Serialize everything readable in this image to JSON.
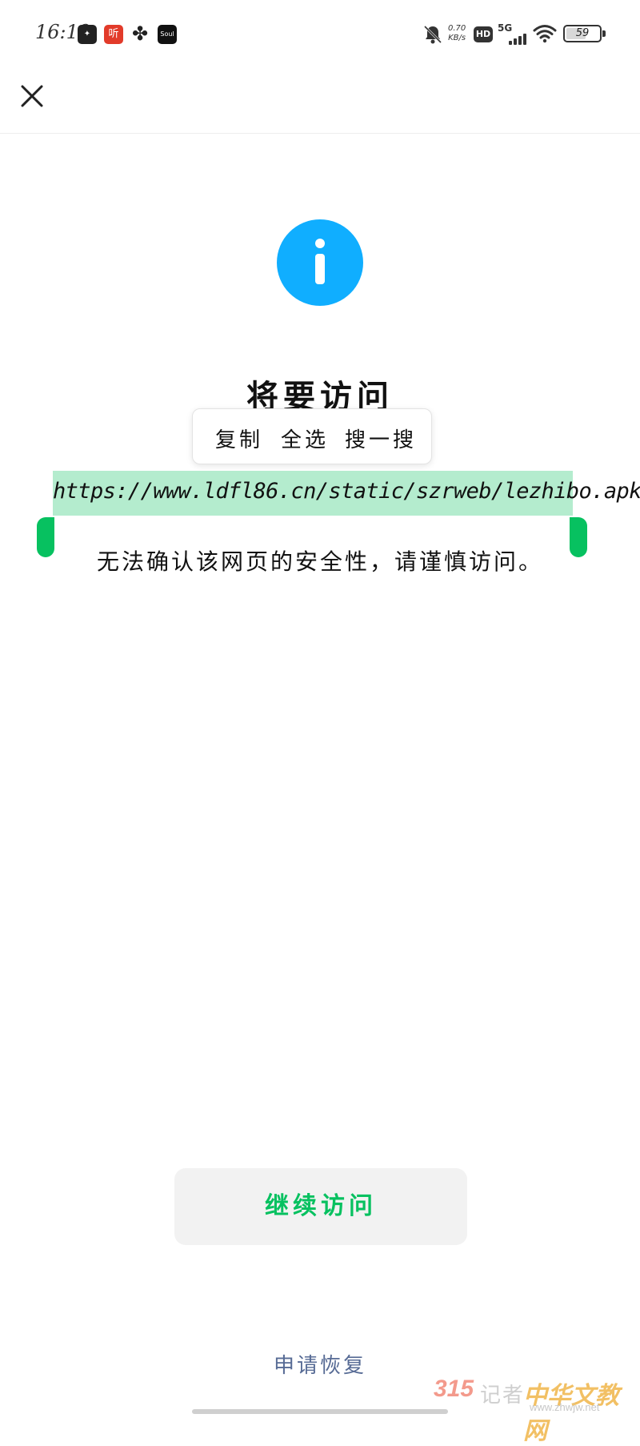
{
  "status_bar": {
    "time": "16:19",
    "app_icons": [
      "app-icon",
      "listen-app-icon",
      "fan-app-icon",
      "soul-app-icon"
    ],
    "listen_label": "听",
    "soul_label": "Soul",
    "network_speed": "0.70",
    "network_speed_unit": "KB/s",
    "hd_label": "HD",
    "network_type": "5G",
    "battery_level": "59",
    "battery_fraction": 0.59
  },
  "header": {
    "close_icon": "close-icon"
  },
  "dialog": {
    "icon": "info-icon",
    "icon_color": "#10aeff",
    "title": "将要访问",
    "url": "https://www.ldfl86.cn/static/szrweb/lezhibo.apk",
    "warning": "无法确认该网页的安全性，请谨慎访问。",
    "selection_menu": {
      "copy": "复制",
      "select_all": "全选",
      "search": "搜一搜"
    },
    "selection_highlight_color": "#b4ecce",
    "accent_color": "#07c160"
  },
  "actions": {
    "continue_label": "继续访问",
    "restore_label": "申请恢复",
    "link_color": "#576b95"
  },
  "watermark": {
    "brand_number": "315",
    "brand_text": "记者",
    "site_name": "中华文教网",
    "site_url": "www.zhwjw.net"
  }
}
